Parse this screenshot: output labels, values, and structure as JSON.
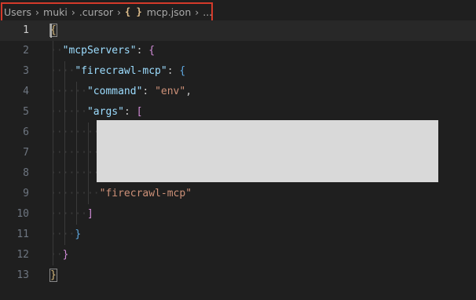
{
  "breadcrumb": {
    "items": [
      "Users",
      "muki",
      ".cursor",
      "mcp.json",
      "..."
    ],
    "file_icon": "{ }",
    "separator": "›"
  },
  "editor": {
    "current_line": 1,
    "lines": [
      {
        "n": "1"
      },
      {
        "n": "2",
        "key": "\"mcpServers\"",
        "colon": ": ",
        "open": "{"
      },
      {
        "n": "3",
        "key": "\"firecrawl-mcp\"",
        "colon": ": ",
        "open": "{"
      },
      {
        "n": "4",
        "key": "\"command\"",
        "colon": ": ",
        "value": "\"env\"",
        "comma": ","
      },
      {
        "n": "5",
        "key": "\"args\"",
        "colon": ": ",
        "open": "["
      },
      {
        "n": "6"
      },
      {
        "n": "7"
      },
      {
        "n": "8"
      },
      {
        "n": "9",
        "value": "\"firecrawl-mcp\""
      },
      {
        "n": "10",
        "close": "]"
      },
      {
        "n": "11",
        "close": "}"
      },
      {
        "n": "12",
        "close": "}"
      },
      {
        "n": "13"
      }
    ],
    "root_open": "{",
    "root_close": "}"
  }
}
